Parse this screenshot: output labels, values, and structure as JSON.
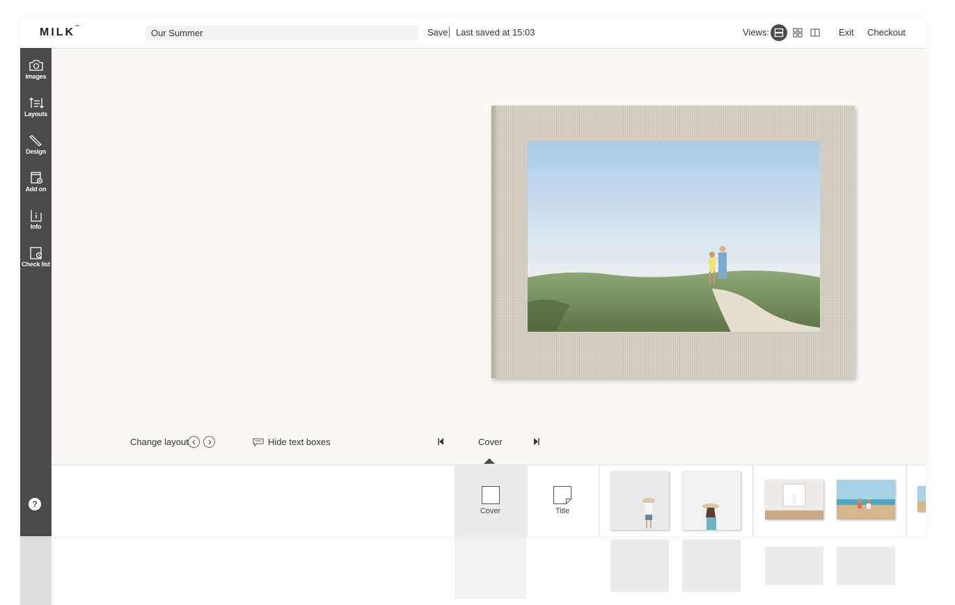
{
  "brand": {
    "logo": "MILK",
    "tm": "™"
  },
  "header": {
    "title_value": "Our Summer",
    "save_label": "Save",
    "last_saved": "Last saved at 15:03",
    "views_label": "Views:",
    "exit_label": "Exit",
    "checkout_label": "Checkout"
  },
  "sidebar": {
    "items": [
      {
        "label": "Images",
        "icon": "camera-icon"
      },
      {
        "label": "Layouts",
        "icon": "layouts-icon"
      },
      {
        "label": "Design",
        "icon": "pencil-icon"
      },
      {
        "label": "Add on",
        "icon": "add-on-icon"
      },
      {
        "label": "Info",
        "icon": "info-icon"
      },
      {
        "label": "Check list",
        "icon": "checklist-icon"
      }
    ],
    "help": "?"
  },
  "controls": {
    "change_layout": "Change layout",
    "hide_text": "Hide text boxes",
    "current_page": "Cover"
  },
  "strip": {
    "cover_label": "Cover",
    "title_label": "Title"
  },
  "colors": {
    "sidebar": "#4a4a4a",
    "canvas": "#faf8f5",
    "cover_linen": "#d3cfc3"
  }
}
